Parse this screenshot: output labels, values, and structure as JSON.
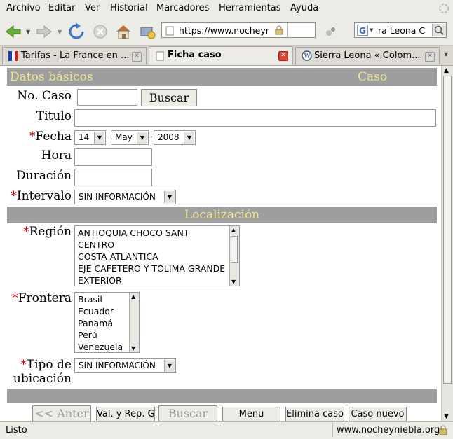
{
  "menubar": {
    "items": [
      "Archivo",
      "Editar",
      "Ver",
      "Historial",
      "Marcadores",
      "Herramientas",
      "Ayuda"
    ]
  },
  "navbar": {
    "url": "https://www.nocheyr",
    "search_value": "ra Leona C",
    "search_engine": "G"
  },
  "tabs": [
    {
      "label": "Tarifas - La France en ..."
    },
    {
      "label": "Ficha caso"
    },
    {
      "label": "Sierra Leona « Colom..."
    }
  ],
  "form": {
    "section_basic": "Datos básicos",
    "section_basic_right": "Caso",
    "no_caso_label": "No. Caso",
    "buscar_label": "Buscar",
    "titulo_label": "Titulo",
    "fecha_label": "Fecha",
    "fecha_day": "14",
    "fecha_month": "May",
    "fecha_year": "2008",
    "fecha_sep": "-",
    "hora_label": "Hora",
    "duracion_label": "Duración",
    "intervalo_label": "Intervalo",
    "intervalo_value": "SIN INFORMACIÓN",
    "section_location": "Localización",
    "region_label": "Región",
    "regions": [
      "ANTIOQUIA CHOCO SANT",
      "CENTRO",
      "COSTA ATLANTICA",
      "EJE CAFETERO Y TOLIMA GRANDE",
      "EXTERIOR"
    ],
    "frontera_label": "Frontera",
    "fronteras": [
      "Brasil",
      "Ecuador",
      "Panamá",
      "Perú",
      "Venezuela"
    ],
    "tipo_label_1": "Tipo de",
    "tipo_label_2": "ubicación",
    "tipo_value": "SIN INFORMACIÓN",
    "required_mark": "*"
  },
  "bottom_buttons": {
    "anterior": "<< Anter",
    "val_rep": "Val. y Rep. G",
    "buscar": "Buscar",
    "menu": "Menu",
    "elimina": "Elimina caso",
    "nuevo": "Caso nuevo"
  },
  "status": {
    "text": "Listo",
    "domain": "www.nocheyniebla.org"
  }
}
